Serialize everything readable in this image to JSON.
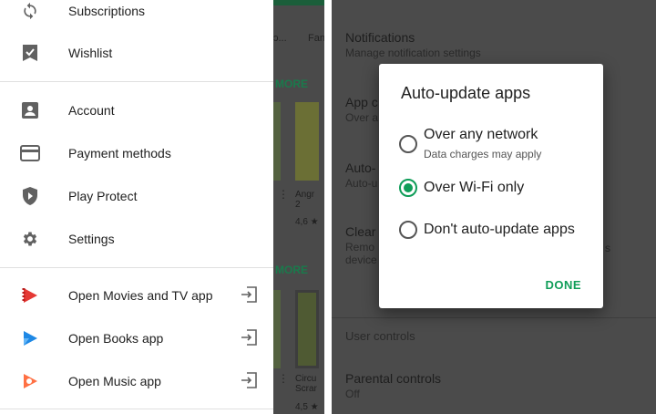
{
  "drawer": {
    "items": [
      {
        "label": "Subscriptions",
        "icon": "subscriptions-icon"
      },
      {
        "label": "Wishlist",
        "icon": "wishlist-icon"
      },
      {
        "label": "Account",
        "icon": "account-icon"
      },
      {
        "label": "Payment methods",
        "icon": "payment-card-icon"
      },
      {
        "label": "Play Protect",
        "icon": "shield-icon"
      },
      {
        "label": "Settings",
        "icon": "gear-icon"
      },
      {
        "label": "Open Movies and TV app",
        "icon": "movies-icon"
      },
      {
        "label": "Open Books app",
        "icon": "books-icon"
      },
      {
        "label": "Open Music app",
        "icon": "music-icon"
      }
    ]
  },
  "behind": {
    "tab1": "ɔ...",
    "tab2": "Fan",
    "more1": "MORE",
    "more2": "MORE",
    "app1_line1": "Angr",
    "app1_line2": "2",
    "app1_rating": "4,6 ★",
    "app2_line1": "Circu",
    "app2_line2": "Scrar",
    "app2_rating": "4,5 ★"
  },
  "settings_bg": {
    "notifications_title": "Notifications",
    "notifications_sub": "Manage notification settings",
    "app_frag": "App c",
    "app_sub_frag": "Over a",
    "auto_frag": "Auto-",
    "auto_sub_frag": "Auto-u",
    "clear_frag": "Clear",
    "clear_sub1": "Remo",
    "clear_sub2": "device",
    "clear_right": "s",
    "user_controls": "User controls",
    "parental_title": "Parental controls",
    "parental_sub": "Off"
  },
  "dialog": {
    "title": "Auto-update apps",
    "options": [
      {
        "label": "Over any network",
        "sub": "Data charges may apply",
        "selected": false
      },
      {
        "label": "Over Wi-Fi only",
        "sub": "",
        "selected": true
      },
      {
        "label": "Don't auto-update apps",
        "sub": "",
        "selected": false
      }
    ],
    "done": "DONE"
  },
  "colors": {
    "accent": "#0f9d58",
    "movies": "#e53935",
    "books": "#1e88e5",
    "music": "#ff7043",
    "icon_gray": "#616161"
  }
}
